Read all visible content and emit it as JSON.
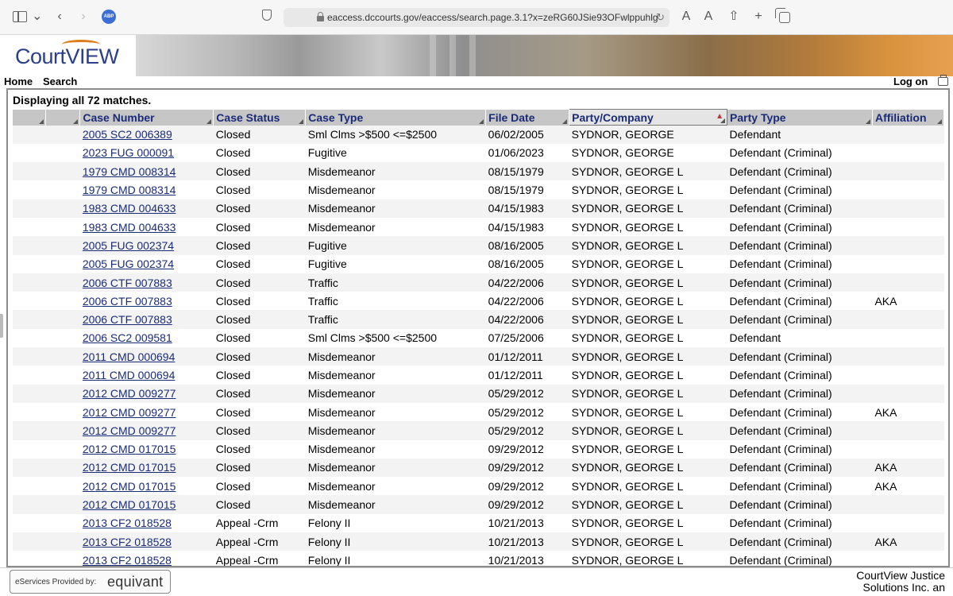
{
  "browser": {
    "url": "eaccess.dccourts.gov/eaccess/search.page.3.1?x=zeRG60JSie93OFwlppuhlg",
    "text_small": "A",
    "text_large": "A"
  },
  "site": {
    "logo_text": "CourtVIEW"
  },
  "nav": {
    "home": "Home",
    "search": "Search",
    "logon": "Log on"
  },
  "results": {
    "summary": "Displaying all 72 matches.",
    "columns": [
      "",
      "",
      "Case Number",
      "Case Status",
      "Case Type",
      "File Date",
      "Party/Company",
      "Party Type",
      "Affiliation"
    ],
    "sorted_column": "Party/Company",
    "rows": [
      {
        "case_number": "2005 SC2 006389",
        "case_status": "Closed",
        "case_type": "Sml Clms >$500 <=$2500",
        "file_date": "06/02/2005",
        "party": "SYDNOR, GEORGE",
        "party_type": "Defendant",
        "affiliation": ""
      },
      {
        "case_number": "2023 FUG 000091",
        "case_status": "Closed",
        "case_type": "Fugitive",
        "file_date": "01/06/2023",
        "party": "SYDNOR, GEORGE",
        "party_type": "Defendant (Criminal)",
        "affiliation": ""
      },
      {
        "case_number": "1979 CMD 008314",
        "case_status": "Closed",
        "case_type": "Misdemeanor",
        "file_date": "08/15/1979",
        "party": "SYDNOR, GEORGE L",
        "party_type": "Defendant (Criminal)",
        "affiliation": ""
      },
      {
        "case_number": "1979 CMD 008314",
        "case_status": "Closed",
        "case_type": "Misdemeanor",
        "file_date": "08/15/1979",
        "party": "SYDNOR, GEORGE L",
        "party_type": "Defendant (Criminal)",
        "affiliation": ""
      },
      {
        "case_number": "1983 CMD 004633",
        "case_status": "Closed",
        "case_type": "Misdemeanor",
        "file_date": "04/15/1983",
        "party": "SYDNOR, GEORGE L",
        "party_type": "Defendant (Criminal)",
        "affiliation": ""
      },
      {
        "case_number": "1983 CMD 004633",
        "case_status": "Closed",
        "case_type": "Misdemeanor",
        "file_date": "04/15/1983",
        "party": "SYDNOR, GEORGE L",
        "party_type": "Defendant (Criminal)",
        "affiliation": ""
      },
      {
        "case_number": "2005 FUG 002374",
        "case_status": "Closed",
        "case_type": "Fugitive",
        "file_date": "08/16/2005",
        "party": "SYDNOR, GEORGE L",
        "party_type": "Defendant (Criminal)",
        "affiliation": ""
      },
      {
        "case_number": "2005 FUG 002374",
        "case_status": "Closed",
        "case_type": "Fugitive",
        "file_date": "08/16/2005",
        "party": "SYDNOR, GEORGE L",
        "party_type": "Defendant (Criminal)",
        "affiliation": ""
      },
      {
        "case_number": "2006 CTF 007883",
        "case_status": "Closed",
        "case_type": "Traffic",
        "file_date": "04/22/2006",
        "party": "SYDNOR, GEORGE L",
        "party_type": "Defendant (Criminal)",
        "affiliation": ""
      },
      {
        "case_number": "2006 CTF 007883",
        "case_status": "Closed",
        "case_type": "Traffic",
        "file_date": "04/22/2006",
        "party": "SYDNOR, GEORGE L",
        "party_type": "Defendant (Criminal)",
        "affiliation": "AKA"
      },
      {
        "case_number": "2006 CTF 007883",
        "case_status": "Closed",
        "case_type": "Traffic",
        "file_date": "04/22/2006",
        "party": "SYDNOR, GEORGE L",
        "party_type": "Defendant (Criminal)",
        "affiliation": ""
      },
      {
        "case_number": "2006 SC2 009581",
        "case_status": "Closed",
        "case_type": "Sml Clms >$500 <=$2500",
        "file_date": "07/25/2006",
        "party": "SYDNOR, GEORGE L",
        "party_type": "Defendant",
        "affiliation": ""
      },
      {
        "case_number": "2011 CMD 000694",
        "case_status": "Closed",
        "case_type": "Misdemeanor",
        "file_date": "01/12/2011",
        "party": "SYDNOR, GEORGE L",
        "party_type": "Defendant (Criminal)",
        "affiliation": ""
      },
      {
        "case_number": "2011 CMD 000694",
        "case_status": "Closed",
        "case_type": "Misdemeanor",
        "file_date": "01/12/2011",
        "party": "SYDNOR, GEORGE L",
        "party_type": "Defendant (Criminal)",
        "affiliation": ""
      },
      {
        "case_number": "2012 CMD 009277",
        "case_status": "Closed",
        "case_type": "Misdemeanor",
        "file_date": "05/29/2012",
        "party": "SYDNOR, GEORGE L",
        "party_type": "Defendant (Criminal)",
        "affiliation": ""
      },
      {
        "case_number": "2012 CMD 009277",
        "case_status": "Closed",
        "case_type": "Misdemeanor",
        "file_date": "05/29/2012",
        "party": "SYDNOR, GEORGE L",
        "party_type": "Defendant (Criminal)",
        "affiliation": "AKA"
      },
      {
        "case_number": "2012 CMD 009277",
        "case_status": "Closed",
        "case_type": "Misdemeanor",
        "file_date": "05/29/2012",
        "party": "SYDNOR, GEORGE L",
        "party_type": "Defendant (Criminal)",
        "affiliation": ""
      },
      {
        "case_number": "2012 CMD 017015",
        "case_status": "Closed",
        "case_type": "Misdemeanor",
        "file_date": "09/29/2012",
        "party": "SYDNOR, GEORGE L",
        "party_type": "Defendant (Criminal)",
        "affiliation": ""
      },
      {
        "case_number": "2012 CMD 017015",
        "case_status": "Closed",
        "case_type": "Misdemeanor",
        "file_date": "09/29/2012",
        "party": "SYDNOR, GEORGE L",
        "party_type": "Defendant (Criminal)",
        "affiliation": "AKA"
      },
      {
        "case_number": "2012 CMD 017015",
        "case_status": "Closed",
        "case_type": "Misdemeanor",
        "file_date": "09/29/2012",
        "party": "SYDNOR, GEORGE L",
        "party_type": "Defendant (Criminal)",
        "affiliation": "AKA"
      },
      {
        "case_number": "2012 CMD 017015",
        "case_status": "Closed",
        "case_type": "Misdemeanor",
        "file_date": "09/29/2012",
        "party": "SYDNOR, GEORGE L",
        "party_type": "Defendant (Criminal)",
        "affiliation": ""
      },
      {
        "case_number": "2013 CF2 018528",
        "case_status": "Appeal -Crm",
        "case_type": "Felony II",
        "file_date": "10/21/2013",
        "party": "SYDNOR, GEORGE L",
        "party_type": "Defendant (Criminal)",
        "affiliation": ""
      },
      {
        "case_number": "2013 CF2 018528",
        "case_status": "Appeal -Crm",
        "case_type": "Felony II",
        "file_date": "10/21/2013",
        "party": "SYDNOR, GEORGE L",
        "party_type": "Defendant (Criminal)",
        "affiliation": "AKA"
      },
      {
        "case_number": "2013 CF2 018528",
        "case_status": "Appeal -Crm",
        "case_type": "Felony II",
        "file_date": "10/21/2013",
        "party": "SYDNOR, GEORGE L",
        "party_type": "Defendant (Criminal)",
        "affiliation": ""
      }
    ]
  },
  "footer": {
    "provided_label": "eServices Provided by:",
    "provider_brand": "equivant",
    "copyright_line1": "CourtView Justice",
    "copyright_line2": "Solutions Inc. an"
  },
  "colors": {
    "link": "#1a2b78",
    "header_bg": "#c6c6c6",
    "row_alt": "#f3f3f3",
    "logo_accent": "#e07b1a"
  }
}
